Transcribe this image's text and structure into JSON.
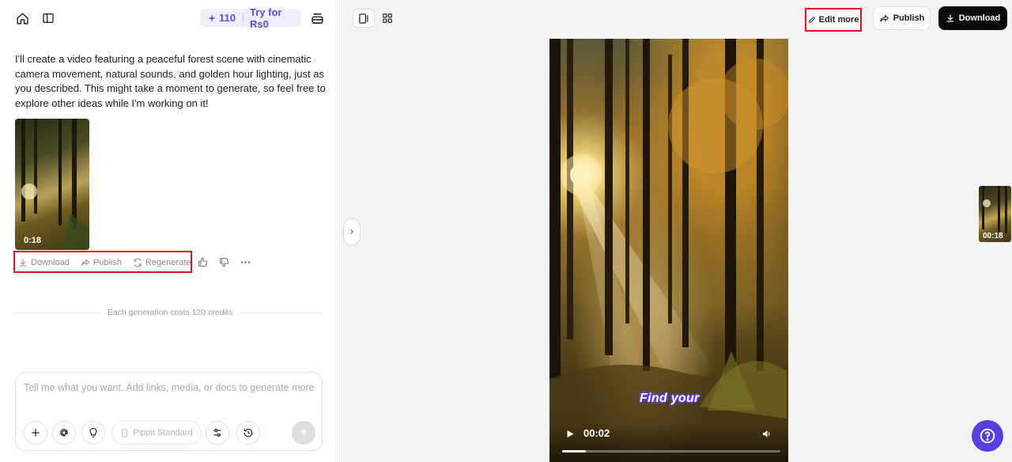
{
  "header": {
    "credits": "110",
    "try_label": "Try for Rs0"
  },
  "chat": {
    "message": "I'll create a video featuring a peaceful forest scene with cinematic camera movement, natural sounds, and golden hour lighting, just as you described. This might take a moment to generate, so feel free to explore other ideas while I'm working on it!",
    "thumbnail_duration": "0:18",
    "actions": {
      "download": "Download",
      "publish": "Publish",
      "regenerate": "Regenerate"
    },
    "cost_note": "Each generation costs 120 credits"
  },
  "composer": {
    "placeholder": "Tell me what you want. Add links, media, or docs to generate more",
    "model": "Pippit Standard"
  },
  "preview": {
    "edit_more": "Edit more",
    "publish": "Publish",
    "download": "Download",
    "subtitle": "Find your",
    "current_time": "00:02",
    "progress": 0.11,
    "side_thumb_duration": "00:18"
  },
  "colors": {
    "accent": "#5b3ee0",
    "highlight_box": "#e0141c"
  }
}
